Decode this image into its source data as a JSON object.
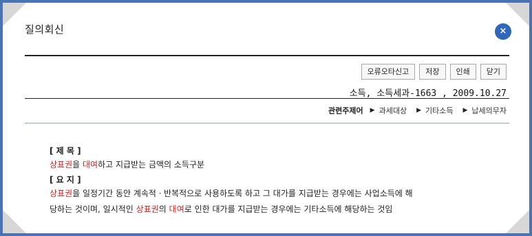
{
  "dialog": {
    "title": "질의회신",
    "close_label": "×"
  },
  "toolbar": {
    "report_label": "오류오타신고",
    "save_label": "저장",
    "print_label": "인쇄",
    "close_label": "닫기"
  },
  "document": {
    "reference": "소득, 소득세과-1663 , 2009.10.27"
  },
  "related": {
    "label": "관련주제어",
    "items": [
      "과세대상",
      "기타소득",
      "납세의무자"
    ]
  },
  "content": {
    "subject_heading": "[ 제 목 ]",
    "subject": [
      "상표권",
      "을 ",
      "대여",
      "하고 지급받는 금액의 소득구분"
    ],
    "summary_heading": "[ 요 지 ]",
    "summary_line1": [
      "상표권",
      "을 일정기간 동안 계속적ㆍ반복적으로 사용하도록 하고 그 대가를 지급받는 경우에는 사업소득에 해"
    ],
    "summary_line2": [
      "당하는 것이며, 일시적인 ",
      "상표권",
      "의 ",
      "대여",
      "로 인한 대가를 지급받는 경우에는 기타소득에 해당하는 것임"
    ]
  },
  "colors": {
    "accent": "#2f68b8",
    "highlight": "#e02020",
    "frame": "#4a73b0"
  }
}
